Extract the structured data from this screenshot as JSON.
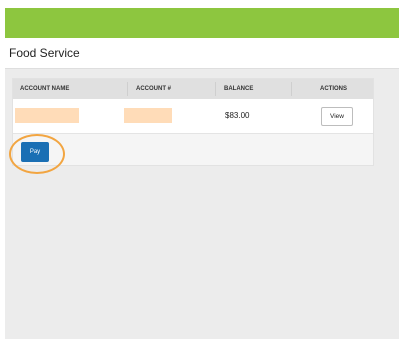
{
  "header": {
    "title": "Food Service"
  },
  "table": {
    "columns": [
      "ACCOUNT NAME",
      "ACCOUNT #",
      "BALANCE",
      "ACTIONS"
    ],
    "rows": [
      {
        "account_name": "",
        "account_number": "",
        "balance": "$83.00",
        "action_label": "View"
      }
    ]
  },
  "pay_button": {
    "label": "Pay"
  },
  "colors": {
    "top_bar": "#8dc63f",
    "pay_button": "#1a6fb4",
    "highlight_ring": "#f2a541",
    "redaction": "#ffdcb8"
  }
}
